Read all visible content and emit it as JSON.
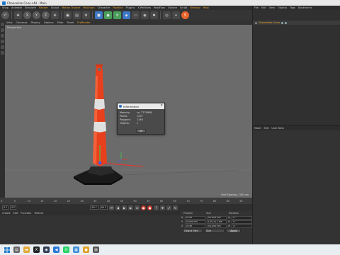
{
  "window": {
    "title": "Channelize Cone.c4d - Main"
  },
  "menubar": [
    "Snap",
    "Animate",
    "Simulate",
    "Render",
    "Sculpt",
    "Motion Tracker",
    "MoGraph",
    "Character",
    "Pipeline",
    "Plugins",
    "X-Particles",
    "RealFlow",
    "Octane",
    "Script",
    "Window",
    "Help"
  ],
  "menubar_highlight": [
    "Render",
    "Motion Tracker",
    "MoGraph",
    "Pipeline",
    "Window",
    "Help"
  ],
  "viewport_menu": [
    "View",
    "Cameras",
    "Display",
    "Options",
    "Filter",
    "Panel",
    "ProRender"
  ],
  "viewport": {
    "label": "Perspective",
    "grid_spacing": "Grid Spacing : 100 cm"
  },
  "info_dialog": {
    "title": "Information",
    "rows": [
      {
        "key": "Memory:",
        "value": "ca. 77789KB"
      },
      {
        "key": "Points:",
        "value": "1237"
      },
      {
        "key": "Polygons:",
        "value": "1146"
      },
      {
        "key": "Objects:",
        "value": "1"
      }
    ],
    "ok_label": "OK"
  },
  "timeline": {
    "ticks": [
      "0",
      "5",
      "10",
      "15",
      "20",
      "25",
      "30",
      "35",
      "40",
      "45",
      "50",
      "55",
      "60",
      "65",
      "70",
      "75",
      "80",
      "85",
      "90"
    ]
  },
  "transport": {
    "start": "0 F",
    "current": "0 F",
    "end": "90 F",
    "end2": "90 F"
  },
  "materials_menu": [
    "Create",
    "Edit",
    "Function",
    "Texture"
  ],
  "coordinates": {
    "headers": [
      "Position",
      "Size",
      "Rotation"
    ],
    "rows": [
      {
        "axis": "X",
        "pos": "0 cm",
        "size": "50.005 cm",
        "rot_axis": "H",
        "rot": "0 °"
      },
      {
        "axis": "Y",
        "pos": "0.006 cm",
        "size": "104.211 cm",
        "rot_axis": "P",
        "rot": "0 °"
      },
      {
        "axis": "Z",
        "pos": "0 cm",
        "size": "50.009 cm",
        "rot_axis": "B",
        "rot": "0 °"
      }
    ],
    "mode": "Object (Rel)",
    "size_mode": "Size",
    "apply": "Apply"
  },
  "object_manager": {
    "menu": [
      "File",
      "Edit",
      "View",
      "Objects",
      "Tags",
      "Bookmarks"
    ],
    "object": "Channelize Cone"
  },
  "attribute_manager": {
    "menu": [
      "Mode",
      "Edit",
      "User Data"
    ]
  },
  "colors": {
    "accent": "#f2a531",
    "cone_orange": "#e8401c",
    "viewport_bg": "#6b6b6b"
  }
}
